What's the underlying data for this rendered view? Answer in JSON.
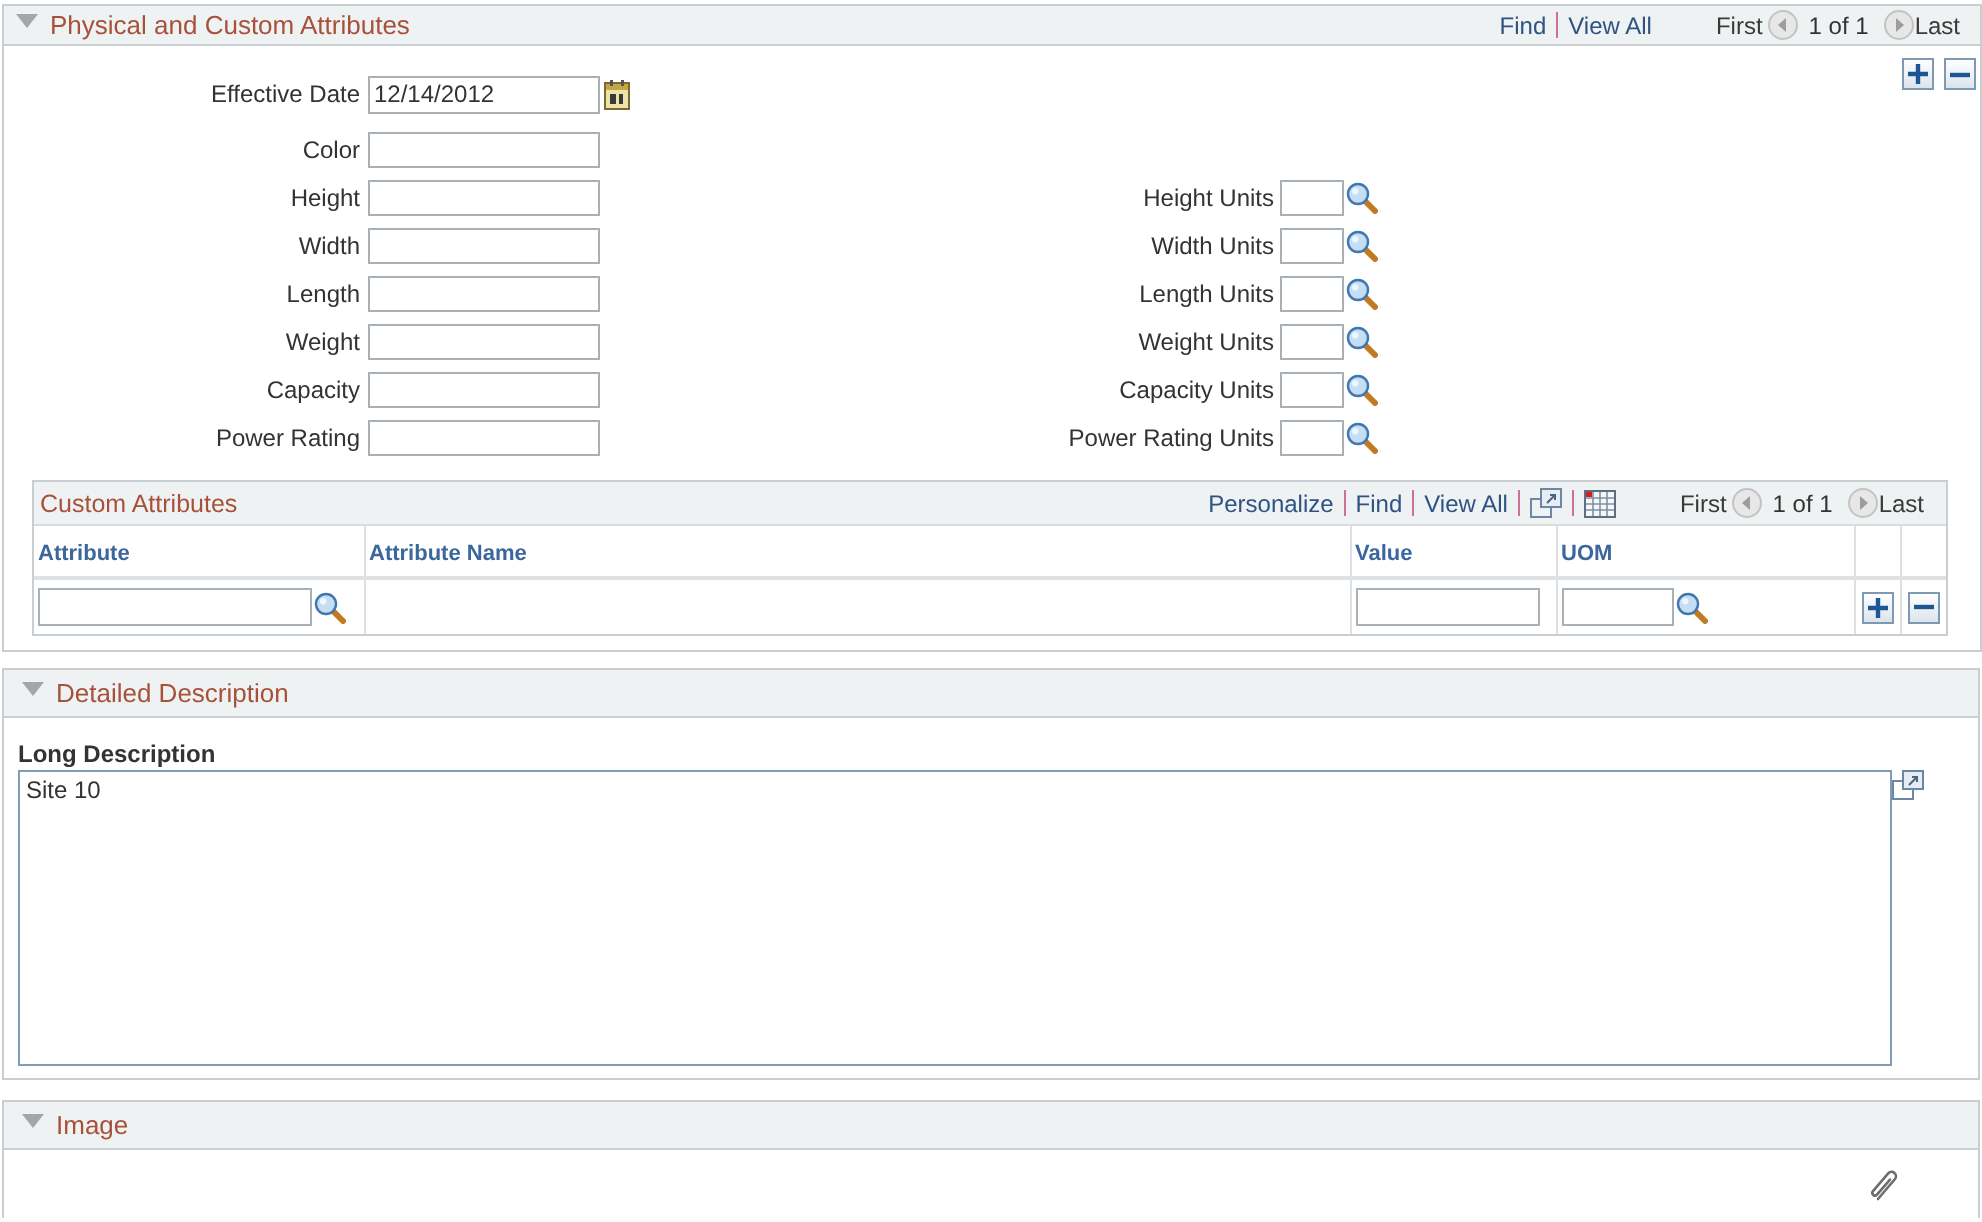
{
  "physical_attributes": {
    "title": "Physical and Custom Attributes",
    "expanded": true,
    "links": [
      "Find",
      "View All"
    ],
    "pager": {
      "first": "First",
      "previous_enabled": false,
      "position": "1 of 1",
      "next_enabled": false,
      "last": "Last"
    },
    "effective_date": {
      "label": "Effective Date",
      "value": "12/14/2012"
    },
    "rows": [
      {
        "label": "Color"
      },
      {
        "label": "Height",
        "units_label": "Height Units"
      },
      {
        "label": "Width",
        "units_label": "Width Units"
      },
      {
        "label": "Length",
        "units_label": "Length Units"
      },
      {
        "label": "Weight",
        "units_label": "Weight Units"
      },
      {
        "label": "Capacity",
        "units_label": "Capacity Units"
      },
      {
        "label": "Power Rating",
        "units_label": "Power Rating Units"
      }
    ],
    "custom_attributes": {
      "title": "Custom Attributes",
      "links": [
        "Personalize",
        "Find",
        "View All"
      ],
      "pager": {
        "first": "First",
        "previous_enabled": false,
        "position": "1 of 1",
        "next_enabled": false,
        "last": "Last"
      },
      "columns": [
        {
          "label": "Attribute",
          "kind": "lookup"
        },
        {
          "label": "Attribute Name",
          "kind": "text"
        },
        {
          "label": "Value",
          "kind": "input"
        },
        {
          "label": "UOM",
          "kind": "lookup"
        }
      ]
    }
  },
  "detailed_description": {
    "title": "Detailed Description",
    "expanded": true,
    "label": "Long Description",
    "value": "Site 10"
  },
  "image": {
    "title": "Image",
    "expanded": true
  }
}
